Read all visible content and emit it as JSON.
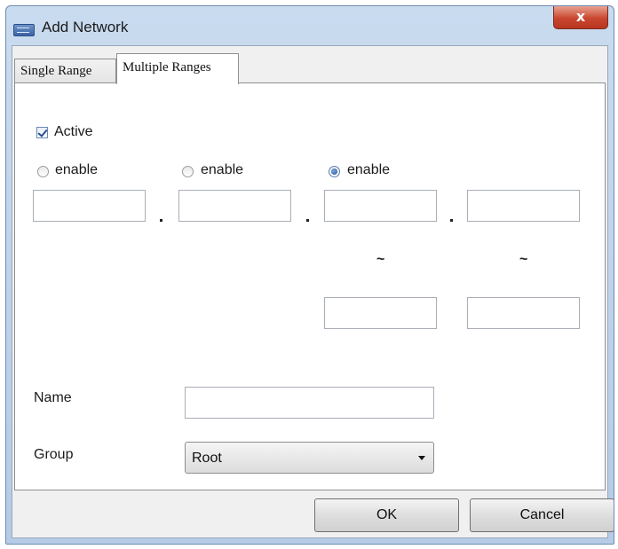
{
  "window": {
    "title": "Add Network",
    "close_glyph": "x"
  },
  "tabs": [
    {
      "label": "Single Range",
      "active": false
    },
    {
      "label": "Multiple Ranges",
      "active": true
    }
  ],
  "form": {
    "active_label": "Active",
    "active_checked": true,
    "octets": [
      {
        "enable_label": "enable",
        "enabled": false,
        "start": "",
        "end": null
      },
      {
        "enable_label": "enable",
        "enabled": false,
        "start": "",
        "end": null
      },
      {
        "enable_label": "enable",
        "enabled": true,
        "start": "",
        "end": ""
      },
      {
        "enable_label": "",
        "enabled": false,
        "start": "",
        "end": ""
      }
    ],
    "separator": ".",
    "range_separator": "~",
    "name_label": "Name",
    "name_value": "",
    "group_label": "Group",
    "group_value": "Root"
  },
  "buttons": {
    "ok": "OK",
    "cancel": "Cancel"
  },
  "icons": {
    "app": "network-app-icon",
    "close": "close-icon",
    "dropdown": "chevron-down-icon",
    "check": "check-icon"
  }
}
